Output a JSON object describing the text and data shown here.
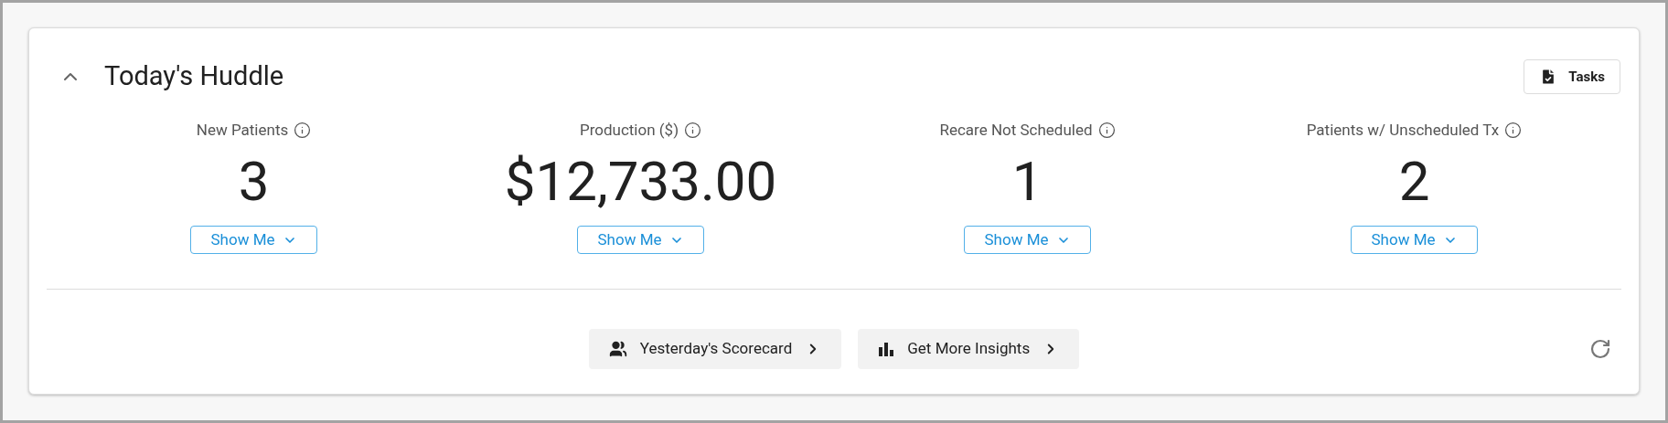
{
  "header": {
    "title": "Today's Huddle",
    "expanded": true,
    "tasks_button": "Tasks"
  },
  "metrics": [
    {
      "label": "New Patients",
      "value": "3",
      "button": "Show Me"
    },
    {
      "label": "Production ($)",
      "value": "$12,733.00",
      "button": "Show Me"
    },
    {
      "label": "Recare Not Scheduled",
      "value": "1",
      "button": "Show Me"
    },
    {
      "label": "Patients w/ Unscheduled Tx",
      "value": "2",
      "button": "Show Me"
    }
  ],
  "footer_buttons": [
    {
      "kind": "people",
      "label": "Yesterday's Scorecard"
    },
    {
      "kind": "chart",
      "label": "Get More Insights"
    }
  ]
}
